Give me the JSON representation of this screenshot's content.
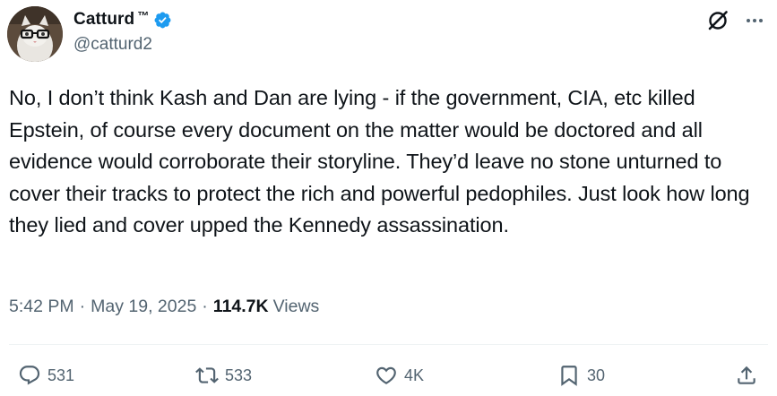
{
  "author": {
    "display_name": "Catturd",
    "tm": "™",
    "handle": "@catturd2",
    "verified": true
  },
  "tweet": {
    "text": "No, I don’t think Kash and Dan are lying - if the government, CIA, etc killed Epstein, of course every document on the matter would be doctored and all evidence would corroborate their storyline. They’d leave no stone unturned to cover their tracks to protect the rich and powerful pedophiles. Just look how long they lied and cover upped the Kennedy assassination.",
    "time": "5:42 PM",
    "date": "May 19, 2025",
    "views_count": "114.7K",
    "views_label": "Views"
  },
  "actions": {
    "replies": "531",
    "reposts": "533",
    "likes": "4K",
    "bookmarks": "30"
  },
  "colors": {
    "text": "#0f1419",
    "secondary": "#536471",
    "verified": "#1d9bf0",
    "divider": "#eff3f4"
  },
  "icons": [
    "verified-badge-icon",
    "grok-icon",
    "more-icon",
    "reply-icon",
    "repost-icon",
    "like-icon",
    "bookmark-icon",
    "share-icon"
  ]
}
